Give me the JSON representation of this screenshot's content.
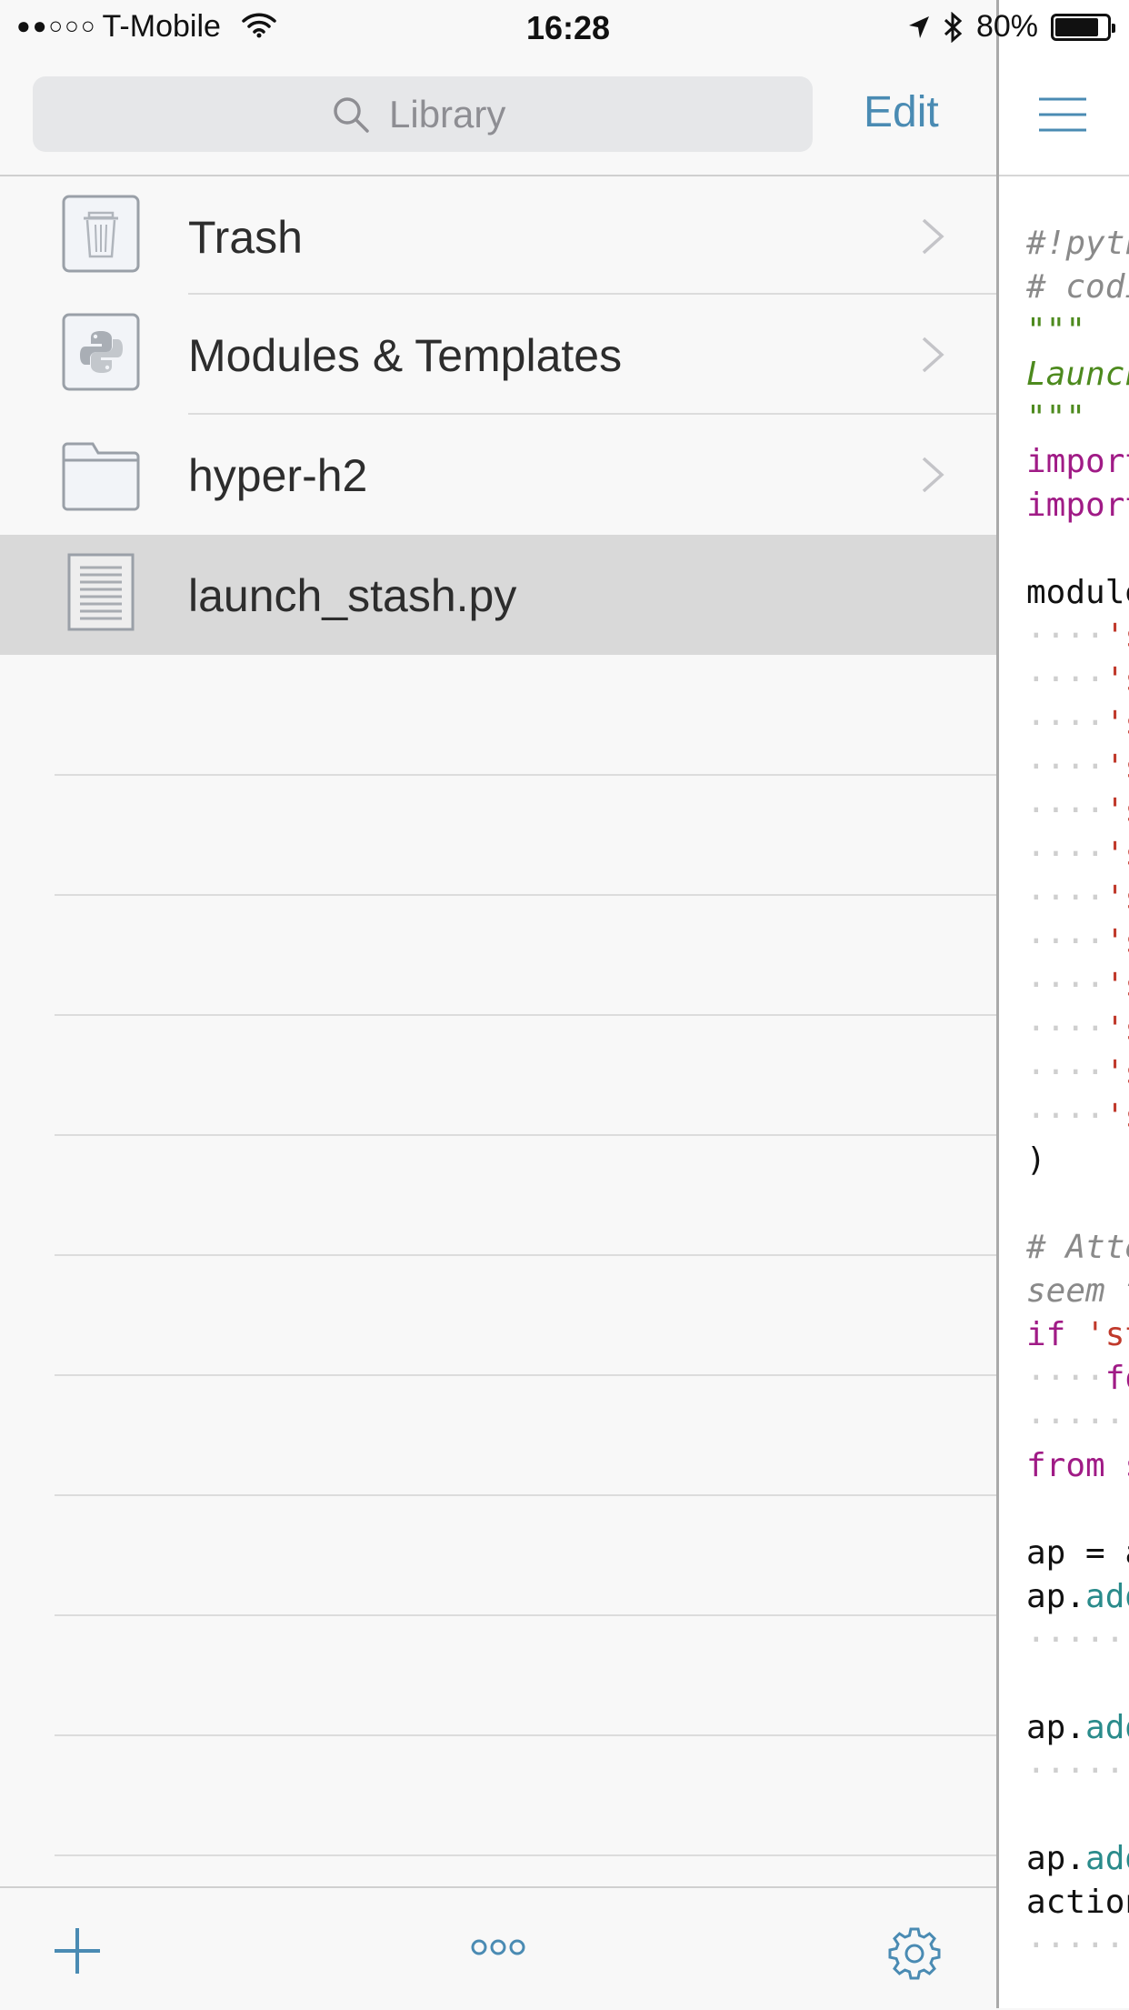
{
  "status_bar": {
    "signal_dots": "●●○○○",
    "carrier": "T-Mobile",
    "time": "16:28",
    "battery_percent": "80%"
  },
  "header": {
    "search_placeholder": "Library",
    "edit_label": "Edit"
  },
  "library": {
    "items": [
      {
        "label": "Trash",
        "icon": "trash-icon",
        "has_chevron": true,
        "selected": false
      },
      {
        "label": "Modules & Templates",
        "icon": "python-icon",
        "has_chevron": true,
        "selected": false
      },
      {
        "label": "hyper-h2",
        "icon": "folder-icon",
        "has_chevron": true,
        "selected": false
      },
      {
        "label": "launch_stash.py",
        "icon": "document-icon",
        "has_chevron": false,
        "selected": true
      }
    ]
  },
  "toolbar": {
    "add_icon": "plus-icon",
    "more_icon": "more-icon",
    "settings_icon": "gear-icon"
  },
  "editor": {
    "menu_icon": "hamburger-icon",
    "lines": [
      {
        "cls": "c-com",
        "text": "#!pyth"
      },
      {
        "cls": "c-com",
        "text": "# codi"
      },
      {
        "cls": "c-str",
        "text": "\"\"\""
      },
      {
        "cls": "c-doc",
        "text": "Launch"
      },
      {
        "cls": "c-str",
        "text": "\"\"\""
      },
      {
        "cls": "c-kw",
        "text": "import"
      },
      {
        "cls": "c-kw",
        "text": "import"
      },
      {
        "cls": "",
        "text": ""
      },
      {
        "cls": "",
        "text": "module"
      },
      {
        "cls": "mixed",
        "dots": "····",
        "text": "'s"
      },
      {
        "cls": "mixed",
        "dots": "····",
        "text": "'s"
      },
      {
        "cls": "mixed",
        "dots": "····",
        "text": "'s"
      },
      {
        "cls": "mixed",
        "dots": "····",
        "text": "'s"
      },
      {
        "cls": "mixed",
        "dots": "····",
        "text": "'s"
      },
      {
        "cls": "mixed",
        "dots": "····",
        "text": "'s"
      },
      {
        "cls": "mixed",
        "dots": "····",
        "text": "'s"
      },
      {
        "cls": "mixed",
        "dots": "····",
        "text": "'s"
      },
      {
        "cls": "mixed",
        "dots": "····",
        "text": "'s"
      },
      {
        "cls": "mixed",
        "dots": "····",
        "text": "'s"
      },
      {
        "cls": "mixed",
        "dots": "····",
        "text": "'s"
      },
      {
        "cls": "mixed",
        "dots": "····",
        "text": "'s"
      },
      {
        "cls": "",
        "text": ")"
      },
      {
        "cls": "",
        "text": ""
      },
      {
        "cls": "c-com",
        "text": "# Atte"
      },
      {
        "cls": "c-com",
        "text": "seem t"
      },
      {
        "cls": "kwred",
        "kw": "if ",
        "text": "'st"
      },
      {
        "cls": "dotkw",
        "dots": "····",
        "text": "fo"
      },
      {
        "cls": "c-dot",
        "text": "······"
      },
      {
        "cls": "c-kw",
        "text": "from s"
      },
      {
        "cls": "",
        "text": ""
      },
      {
        "cls": "",
        "text": "ap = a"
      },
      {
        "cls": "apteal",
        "pre": "ap.",
        "text": "add"
      },
      {
        "cls": "c-dot",
        "text": "······"
      },
      {
        "cls": "",
        "text": ""
      },
      {
        "cls": "apteal",
        "pre": "ap.",
        "text": "add"
      },
      {
        "cls": "c-dot",
        "text": "······"
      },
      {
        "cls": "",
        "text": ""
      },
      {
        "cls": "apteal",
        "pre": "ap.",
        "text": "add"
      },
      {
        "cls": "",
        "text": "action"
      },
      {
        "cls": "c-dot",
        "text": "······"
      }
    ]
  }
}
